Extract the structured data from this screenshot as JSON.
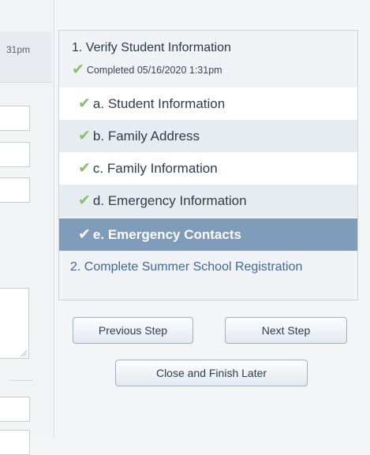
{
  "left": {
    "header_time": "31pm"
  },
  "steps": {
    "step1": {
      "title": "1. Verify Student Information",
      "status": "Completed 05/16/2020 1:31pm"
    },
    "substeps": [
      {
        "label": "a. Student Information",
        "completed": true,
        "active": false
      },
      {
        "label": "b. Family Address",
        "completed": true,
        "active": false
      },
      {
        "label": "c. Family Information",
        "completed": true,
        "active": false
      },
      {
        "label": "d. Emergency Information",
        "completed": true,
        "active": false
      },
      {
        "label": "e. Emergency Contacts",
        "completed": true,
        "active": true
      }
    ],
    "step2": {
      "title": "2. Complete Summer School Registration"
    }
  },
  "buttons": {
    "previous": "Previous Step",
    "next": "Next Step",
    "close": "Close and Finish Later"
  },
  "icons": {
    "check": "checkmark-icon"
  },
  "colors": {
    "active_bg": "#7f9cbb",
    "check": "#86c26a",
    "link": "#3c6a9b"
  }
}
